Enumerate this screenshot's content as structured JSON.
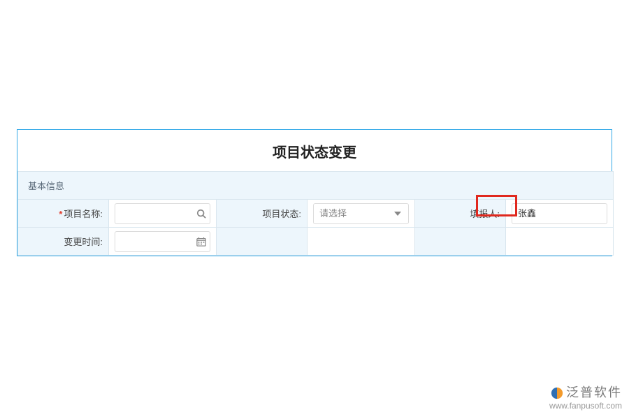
{
  "form": {
    "title": "项目状态变更",
    "section_header": "基本信息",
    "fields": {
      "project_name": {
        "label": "项目名称:",
        "value": "",
        "required": true
      },
      "project_status": {
        "label": "项目状态:",
        "placeholder": "请选择"
      },
      "reporter": {
        "label": "填报人:",
        "value": "张鑫"
      },
      "change_time": {
        "label": "变更时间:",
        "value": ""
      }
    }
  },
  "brand": {
    "name": "泛普软件",
    "url": "www.fanpusoft.com"
  }
}
